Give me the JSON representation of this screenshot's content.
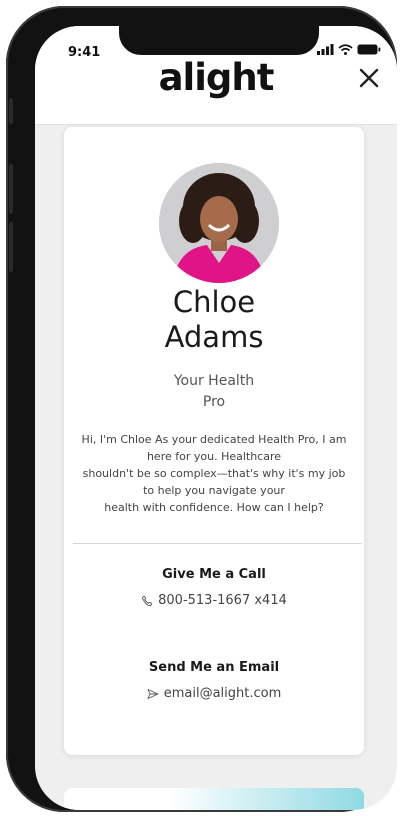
{
  "status_bar": {
    "time": "9:41"
  },
  "header": {
    "logo": "alight"
  },
  "profile": {
    "first_name": "Chloe",
    "last_name": "Adams",
    "role_line1": "Your Health",
    "role_line2": "Pro",
    "bio_lines": [
      "Hi, I'm Chloe As your dedicated Health Pro, I am",
      "here for you. Healthcare",
      "shouldn't be so complex—that's why it's my job",
      "to help you navigate your",
      "health with confidence. How can I help?"
    ]
  },
  "contact": {
    "call_label": "Give Me a Call",
    "phone": "800-513-1667 x414",
    "email_label": "Send Me an Email",
    "email": "email@alight.com"
  },
  "colors": {
    "next_card_accent": "#8fd9e2",
    "avatar_top": "#e01487"
  }
}
